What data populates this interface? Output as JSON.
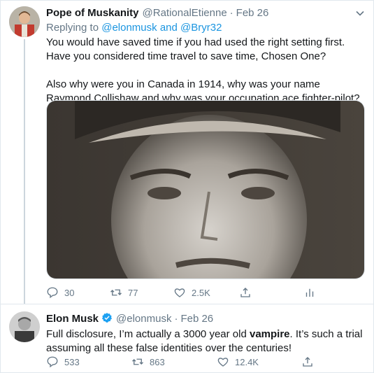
{
  "tweets": [
    {
      "author": {
        "name": "Pope of Muskanity",
        "handle": "@RationalEtienne",
        "verified": false
      },
      "separator": "·",
      "date": "Feb 26",
      "replying": {
        "prefix": "Replying to ",
        "user1": "@elonmusk",
        "connector": " and ",
        "user2": "@Bryr32"
      },
      "text_para1": "You would have saved time if you had used the right setting first. Have you considered time travel to save time, Chosen One?",
      "text_para2": "Also why were you in Canada in 1914, why was your name Raymond Collishaw and why was your occupation ace fighter-pilot?",
      "media": "black-and-white-portrait-photo",
      "stats": {
        "replies": "30",
        "retweets": "77",
        "likes": "2.5K"
      }
    },
    {
      "author": {
        "name": "Elon Musk",
        "handle": "@elonmusk",
        "verified": true
      },
      "separator": "·",
      "date": "Feb 26",
      "text_before": "Full disclosure, I’m actually a 3000 year old ",
      "text_bold": "vampire",
      "text_after": ". It’s such a trial assuming all these false identities over the centuries!",
      "stats": {
        "replies": "533",
        "retweets": "863",
        "likes": "12.4K"
      }
    }
  ],
  "colors": {
    "text": "#14171a",
    "secondary": "#657786",
    "link": "#1b95e0",
    "border": "#e1e8ed",
    "verified": "#1da1f2"
  }
}
